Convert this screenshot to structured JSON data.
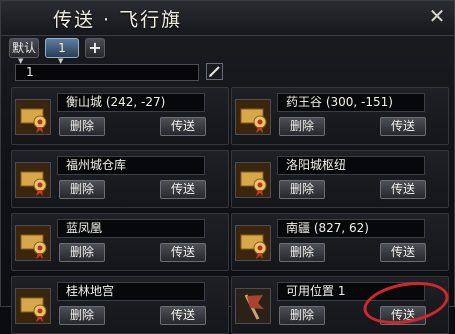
{
  "window": {
    "title": "传送 · 飞行旗",
    "close_glyph": "✕"
  },
  "tabs": {
    "default_label": "默认",
    "tab1_label": "1",
    "add_label": "+"
  },
  "name_field": {
    "value": "1"
  },
  "cards": [
    {
      "location": "衡山城 (242, -27)",
      "delete_label": "删除",
      "teleport_label": "传送",
      "icon": "scroll-icon"
    },
    {
      "location": "药王谷 (300, -151)",
      "delete_label": "删除",
      "teleport_label": "传送",
      "icon": "scroll-icon"
    },
    {
      "location": "福州城仓库",
      "delete_label": "删除",
      "teleport_label": "传送",
      "icon": "scroll-icon"
    },
    {
      "location": "洛阳城枢纽",
      "delete_label": "删除",
      "teleport_label": "传送",
      "icon": "scroll-icon"
    },
    {
      "location": "蓝凤凰",
      "delete_label": "删除",
      "teleport_label": "传送",
      "icon": "scroll-icon"
    },
    {
      "location": "南疆 (827, 62)",
      "delete_label": "删除",
      "teleport_label": "传送",
      "icon": "scroll-icon"
    },
    {
      "location": "桂林地宫",
      "delete_label": "删除",
      "teleport_label": "传送",
      "icon": "scroll-icon"
    },
    {
      "location": "可用位置 1",
      "delete_label": "删除",
      "teleport_label": "传送",
      "icon": "flag-icon"
    }
  ],
  "colors": {
    "highlight_circle": "#d0282a",
    "active_tab": "#5e7ea0"
  }
}
